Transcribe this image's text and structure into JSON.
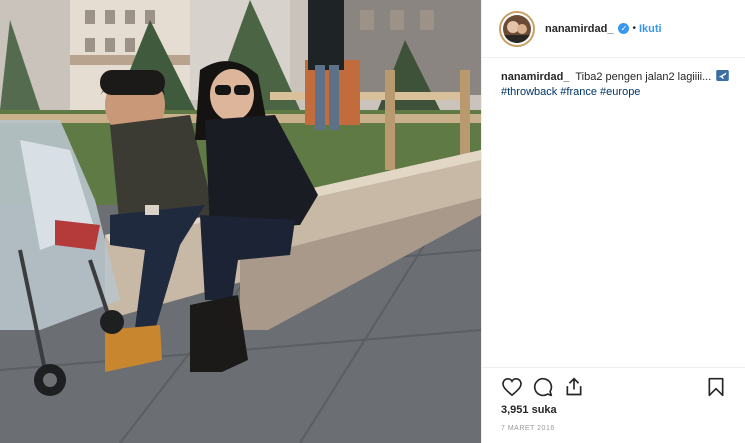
{
  "post": {
    "username": "nanamirdad_",
    "verified": true,
    "separator": "•",
    "follow_label": "Ikuti"
  },
  "caption": {
    "username": "nanamirdad_",
    "text": "Tiba2 pengen jalan2 lagiiii...",
    "emoji_icon": "airplane-icon",
    "hashtags": "#throwback #france #europe"
  },
  "actions": {
    "icons": [
      "heart-icon",
      "comment-icon",
      "share-icon",
      "bookmark-icon"
    ]
  },
  "likes": {
    "count": "3,951",
    "label": "suka"
  },
  "date": "7 MARET 2016",
  "colors": {
    "link_blue": "#3897f0",
    "hashtag_blue": "#003569",
    "text": "#262626",
    "muted": "#999999",
    "border": "#efefef"
  }
}
